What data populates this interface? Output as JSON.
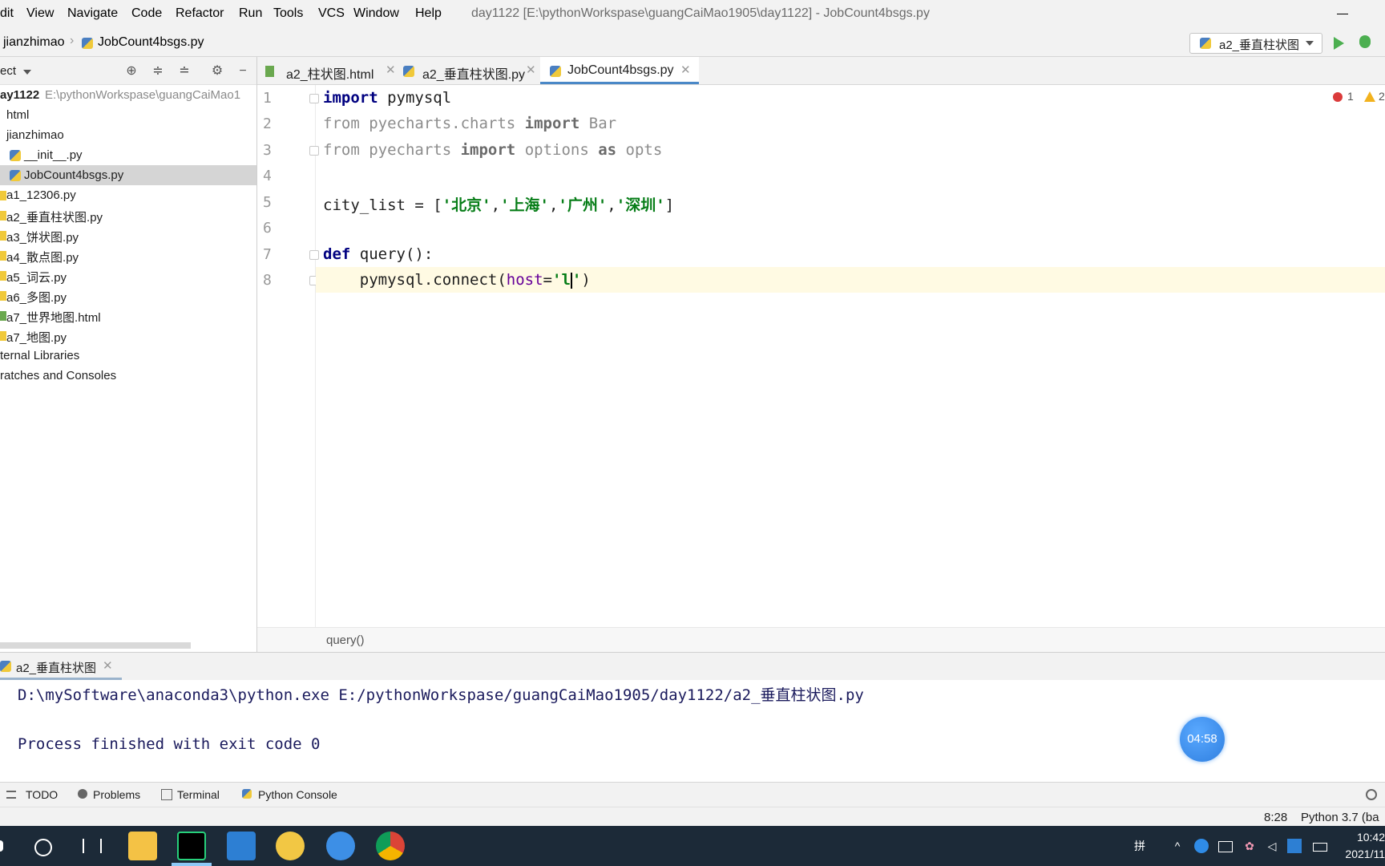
{
  "menu": {
    "items": [
      "dit",
      "View",
      "Navigate",
      "Code",
      "Refactor",
      "Run",
      "Tools",
      "VCS",
      "Window",
      "Help"
    ],
    "window_title": "day1122 [E:\\pythonWorkspase\\guangCaiMao1905\\day1122] - JobCount4bsgs.py"
  },
  "nav": {
    "crumb1": "jianzhimao",
    "crumb2": "JobCount4bsgs.py",
    "run_config": "a2_垂直柱状图"
  },
  "project": {
    "header": "ect",
    "root_name": "ay1122",
    "root_path": "E:\\pythonWorkspase\\guangCaiMao1",
    "items": [
      "html",
      "jianzhimao",
      "__init__.py",
      "JobCount4bsgs.py",
      "a1_12306.py",
      "a2_垂直柱状图.py",
      "a3_饼状图.py",
      "a4_散点图.py",
      "a5_词云.py",
      "a6_多图.py",
      "a7_世界地图.html",
      "a7_地图.py",
      "ternal Libraries",
      "ratches and Consoles"
    ]
  },
  "tabs": [
    "a2_柱状图.html",
    "a2_垂直柱状图.py",
    "JobCount4bsgs.py"
  ],
  "editor": {
    "line_numbers": [
      "1",
      "2",
      "3",
      "4",
      "5",
      "6",
      "7",
      "8"
    ],
    "line1": {
      "kw": "import",
      "rest": " pymysql"
    },
    "line2": {
      "from": "from",
      "mod": " pyecharts.charts ",
      "imp": "import",
      "name": " Bar"
    },
    "line3": {
      "from": "from",
      "mod": " pyecharts ",
      "imp": "import",
      "name": " options ",
      "as": "as",
      "alias": " opts"
    },
    "line5": {
      "pre": "city_list = [",
      "s1": "'北京'",
      "s2": "'上海'",
      "s3": "'广州'",
      "s4": "'深圳'",
      "comma": ",",
      "post": "]"
    },
    "line7": {
      "kw": "def",
      "rest": " query():"
    },
    "line8": {
      "pre": "    pymysql.connect(",
      "param": "host",
      "eq": "=",
      "str1": "'l",
      "str2": "'",
      "post": ")"
    },
    "errors": "1",
    "warnings": "2",
    "breadcrumb": "query()"
  },
  "run": {
    "tab": "a2_垂直柱状图",
    "line1": "D:\\mySoftware\\anaconda3\\python.exe E:/pythonWorkspase/guangCaiMao1905/day1122/a2_垂直柱状图.py",
    "line2": "Process finished with exit code 0",
    "timer": "04:58"
  },
  "toolwindows": [
    "TODO",
    "Problems",
    "Terminal",
    "Python Console"
  ],
  "status": {
    "position": "8:28",
    "interpreter": "Python 3.7 (ba"
  },
  "taskbar": {
    "ime": "拼",
    "time": "10:42",
    "date": "2021/11"
  }
}
